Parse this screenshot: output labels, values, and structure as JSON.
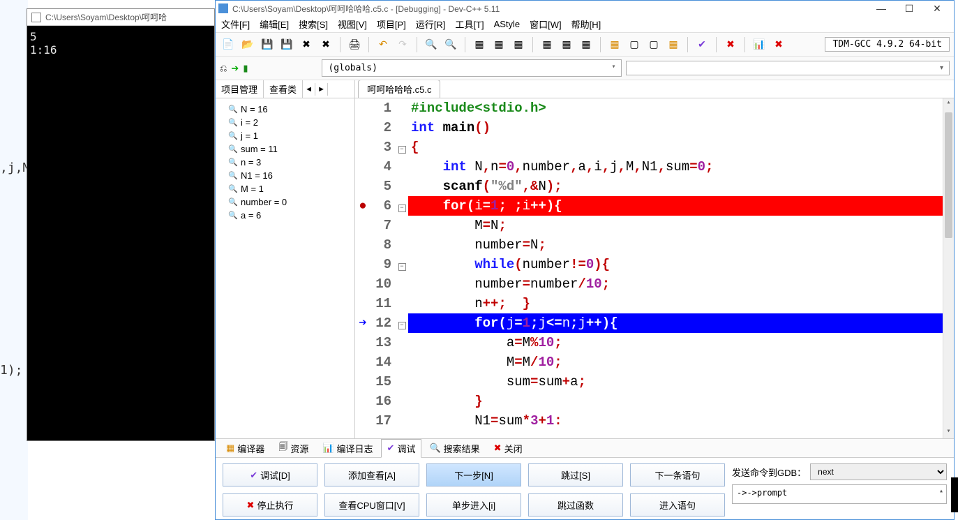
{
  "console": {
    "title": "C:\\Users\\Soyam\\Desktop\\呵呵哈",
    "line1": "5",
    "line2": "1:16"
  },
  "bg": {
    "t1": ",j,M",
    "t2": "1);"
  },
  "devcpp": {
    "title": "C:\\Users\\Soyam\\Desktop\\呵呵哈哈哈.c5.c - [Debugging] - Dev-C++ 5.11",
    "menu": [
      "文件[F]",
      "编辑[E]",
      "搜索[S]",
      "视图[V]",
      "项目[P]",
      "运行[R]",
      "工具[T]",
      "AStyle",
      "窗口[W]",
      "帮助[H]"
    ],
    "compiler": "TDM-GCC 4.9.2 64-bit",
    "scope": "(globals)",
    "left_tabs": [
      "项目管理",
      "查看类"
    ],
    "watch": [
      {
        "n": "N = 16"
      },
      {
        "n": "i = 2"
      },
      {
        "n": "j = 1"
      },
      {
        "n": "sum = 11"
      },
      {
        "n": "n = 3"
      },
      {
        "n": "N1 = 16"
      },
      {
        "n": "M = 1"
      },
      {
        "n": "number = 0"
      },
      {
        "n": "a = 6"
      }
    ],
    "editor_tab": "呵呵哈哈哈.c5.c",
    "bottom_tabs": [
      "编译器",
      "资源",
      "编译日志",
      "调试",
      "搜索结果",
      "关闭"
    ],
    "debug_buttons_row1": [
      "调试[D]",
      "添加查看[A]",
      "下一步[N]",
      "跳过[S]",
      "下一条语句"
    ],
    "debug_buttons_row2": [
      "停止执行",
      "查看CPU窗口[V]",
      "单步进入[i]",
      "跳过函数",
      "进入语句"
    ],
    "gdb_label": "发送命令到GDB：",
    "gdb_cmd": "next",
    "gdb_out": "->->prompt"
  }
}
